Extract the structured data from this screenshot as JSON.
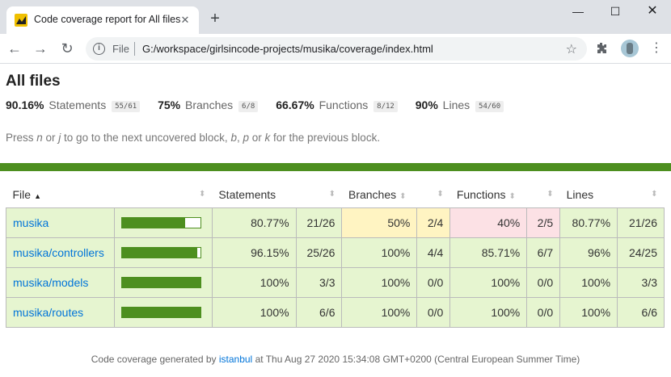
{
  "browser": {
    "tab_title": "Code coverage report for All files",
    "tab_close": "✕",
    "new_tab": "+",
    "window_controls": {
      "minimize": "—",
      "maximize": "☐",
      "close": "✕"
    },
    "nav": {
      "back": "←",
      "forward": "→",
      "reload": "↻"
    },
    "omnibox": {
      "scheme": "File",
      "url": "G:/workspace/girlsincode-projects/musika/coverage/index.html"
    },
    "icons": {
      "info": "info-icon",
      "star": "star-icon",
      "extensions": "puzzle-icon",
      "menu": "kebab-menu-icon"
    }
  },
  "page": {
    "title": "All files",
    "summary": [
      {
        "pct": "90.16%",
        "label": "Statements",
        "fraction": "55/61"
      },
      {
        "pct": "75%",
        "label": "Branches",
        "fraction": "6/8"
      },
      {
        "pct": "66.67%",
        "label": "Functions",
        "fraction": "8/12"
      },
      {
        "pct": "90%",
        "label": "Lines",
        "fraction": "54/60"
      }
    ],
    "hint": {
      "p1": "Press ",
      "k1": "n",
      "p2": " or ",
      "k2": "j",
      "p3": " to go to the next uncovered block, ",
      "k3": "b",
      "p4": ", ",
      "k4": "p",
      "p5": " or ",
      "k5": "k",
      "p6": " for the previous block."
    },
    "table": {
      "headers": {
        "file": "File",
        "statements": "Statements",
        "branches": "Branches",
        "functions": "Functions",
        "lines": "Lines"
      },
      "sort_indicator": "▲",
      "sorter_glyph": "⬍",
      "rows": [
        {
          "file": "musika",
          "coverage": 0.8077,
          "statements_pct": "80.77%",
          "statements_frac": "21/26",
          "branches_pct": "50%",
          "branches_frac": "2/4",
          "functions_pct": "40%",
          "functions_frac": "2/5",
          "lines_pct": "80.77%",
          "lines_frac": "21/26"
        },
        {
          "file": "musika/controllers",
          "coverage": 0.9615,
          "statements_pct": "96.15%",
          "statements_frac": "25/26",
          "branches_pct": "100%",
          "branches_frac": "4/4",
          "functions_pct": "85.71%",
          "functions_frac": "6/7",
          "lines_pct": "96%",
          "lines_frac": "24/25"
        },
        {
          "file": "musika/models",
          "coverage": 1.0,
          "statements_pct": "100%",
          "statements_frac": "3/3",
          "branches_pct": "100%",
          "branches_frac": "0/0",
          "functions_pct": "100%",
          "functions_frac": "0/0",
          "lines_pct": "100%",
          "lines_frac": "3/3"
        },
        {
          "file": "musika/routes",
          "coverage": 1.0,
          "statements_pct": "100%",
          "statements_frac": "6/6",
          "branches_pct": "100%",
          "branches_frac": "0/0",
          "functions_pct": "100%",
          "functions_frac": "0/0",
          "lines_pct": "100%",
          "lines_frac": "6/6"
        }
      ]
    },
    "footer": {
      "prefix": "Code coverage generated by ",
      "link": "istanbul",
      "suffix": " at Thu Aug 27 2020 15:34:08 GMT+0200 (Central European Summer Time)"
    },
    "colors": {
      "high": "#e6f5d0",
      "medium": "#fff4c2",
      "low": "#fce1e5",
      "bar": "#4d8f1f",
      "link": "#0074d9"
    }
  }
}
